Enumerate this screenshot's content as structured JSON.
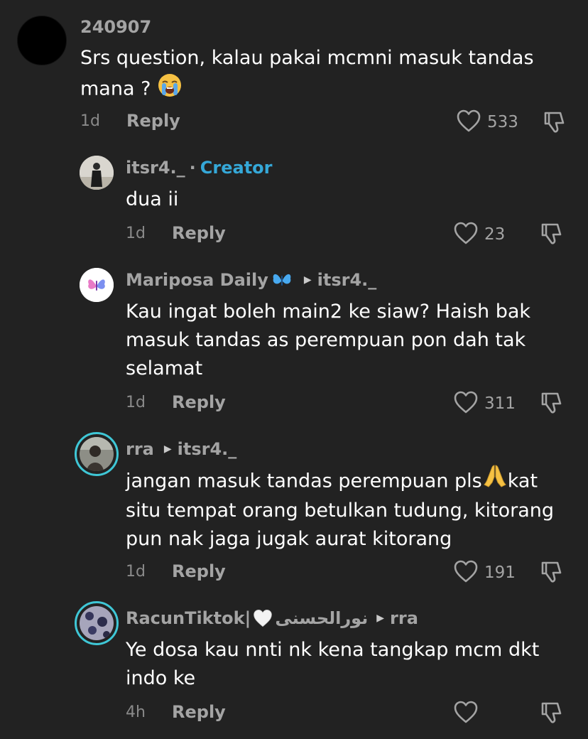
{
  "comments": [
    {
      "username": "240907",
      "text_line1": "Srs question, kalau pakai mcmni masuk tandas",
      "text_line2": "mana ?",
      "emoji_icon": "loudly-crying-face-icon",
      "age": "1d",
      "reply_label": "Reply",
      "likes": "533"
    },
    {
      "username": "itsr4._",
      "separator": "·",
      "badge": "Creator",
      "text": "dua ii",
      "age": "1d",
      "reply_label": "Reply",
      "likes": "23"
    },
    {
      "username": "Mariposa Daily",
      "name_icon": "butterfly-icon",
      "reply_to": "itsr4._",
      "text_line1": "Kau ingat boleh main2 ke siaw? Haish bak",
      "text_line2": "masuk tandas as perempuan pon dah tak",
      "text_line3": "selamat",
      "age": "1d",
      "reply_label": "Reply",
      "likes": "311"
    },
    {
      "username": "rra",
      "reply_to": "itsr4._",
      "text_line1a": "jangan masuk tandas perempuan pls",
      "text_line1b": "kat",
      "emoji_icon": "folded-hands-icon",
      "text_line2": "situ tempat orang betulkan tudung, kitorang",
      "text_line3": "pun nak jaga jugak aurat kitorang",
      "age": "1d",
      "reply_label": "Reply",
      "likes": "191"
    },
    {
      "username_a": "RacunTiktok|",
      "username_b": "نورالحسنى",
      "name_icon": "white-heart-icon",
      "reply_to": "rra",
      "text_line1": "Ye dosa kau nnti nk kena tangkap mcm dkt",
      "text_line2": "indo ke",
      "age": "4h",
      "reply_label": "Reply",
      "likes": ""
    }
  ],
  "colors": {
    "background": "#222222",
    "muted_text": "#a4a4a4",
    "creator_badge": "#35a8d8",
    "story_ring": "#3fc7d6"
  }
}
